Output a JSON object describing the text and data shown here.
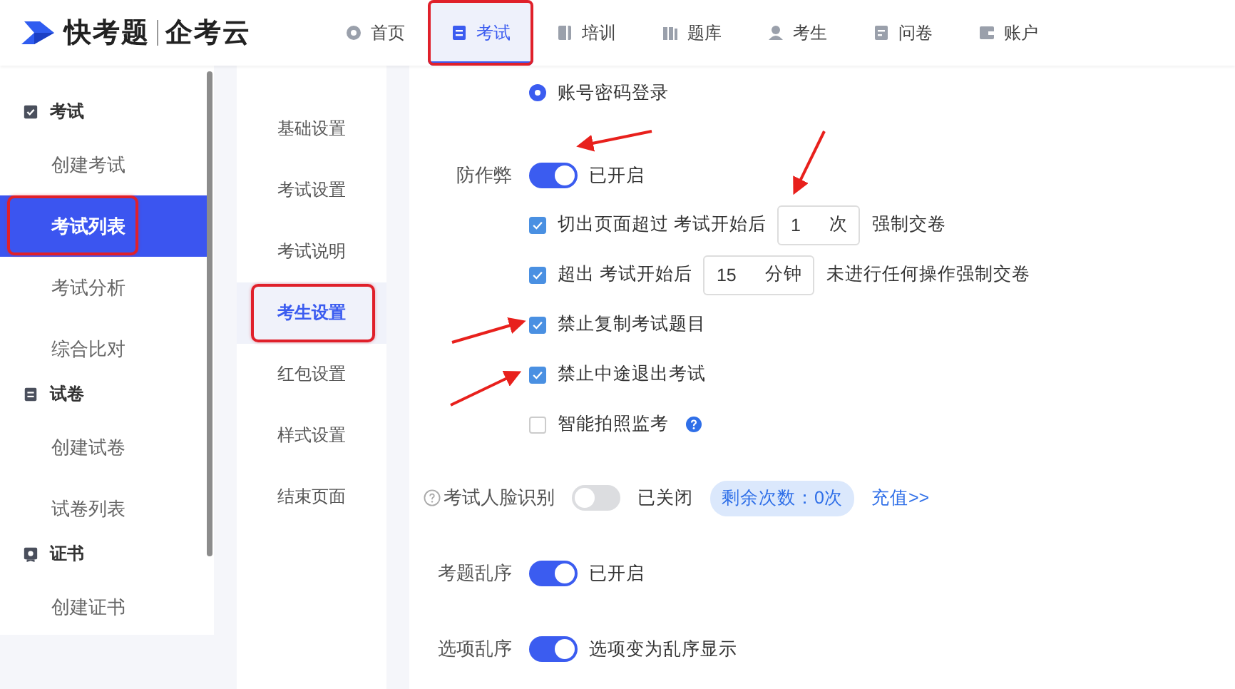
{
  "header": {
    "logo_name": "快考题",
    "logo_sub": "企考云",
    "nav": [
      {
        "label": "首页",
        "selected": false,
        "highlighted": false
      },
      {
        "label": "考试",
        "selected": true,
        "highlighted": true
      },
      {
        "label": "培训",
        "selected": false,
        "highlighted": false
      },
      {
        "label": "题库",
        "selected": false,
        "highlighted": false
      },
      {
        "label": "考生",
        "selected": false,
        "highlighted": false
      },
      {
        "label": "问卷",
        "selected": false,
        "highlighted": false
      },
      {
        "label": "账户",
        "selected": false,
        "highlighted": false
      }
    ]
  },
  "sidebar": {
    "groups": [
      {
        "title": "考试",
        "items": [
          {
            "label": "创建考试",
            "selected": false,
            "highlighted": false
          },
          {
            "label": "考试列表",
            "selected": true,
            "highlighted": true
          },
          {
            "label": "考试分析",
            "selected": false,
            "highlighted": false
          },
          {
            "label": "综合比对",
            "selected": false,
            "highlighted": false
          }
        ]
      },
      {
        "title": "试卷",
        "items": [
          {
            "label": "创建试卷",
            "selected": false,
            "highlighted": false
          },
          {
            "label": "试卷列表",
            "selected": false,
            "highlighted": false
          }
        ]
      },
      {
        "title": "证书",
        "items": [
          {
            "label": "创建证书",
            "selected": false,
            "highlighted": false
          }
        ]
      }
    ]
  },
  "subnav": [
    {
      "label": "基础设置",
      "selected": false,
      "highlighted": false
    },
    {
      "label": "考试设置",
      "selected": false,
      "highlighted": false
    },
    {
      "label": "考试说明",
      "selected": false,
      "highlighted": false
    },
    {
      "label": "考生设置",
      "selected": true,
      "highlighted": true
    },
    {
      "label": "红包设置",
      "selected": false,
      "highlighted": false
    },
    {
      "label": "样式设置",
      "selected": false,
      "highlighted": false
    },
    {
      "label": "结束页面",
      "selected": false,
      "highlighted": false
    }
  ],
  "login_option": {
    "label": "账号密码登录",
    "selected": true
  },
  "anti_cheat": {
    "label": "防作弊",
    "on": true,
    "status": "已开启",
    "options": [
      {
        "kind": "input",
        "checked": true,
        "before": "切出页面超过 考试开始后",
        "value": "1",
        "unit": "次",
        "after": "强制交卷"
      },
      {
        "kind": "input",
        "checked": true,
        "before": "超出 考试开始后",
        "value": "15",
        "unit": "分钟",
        "after": "未进行任何操作强制交卷"
      },
      {
        "kind": "text",
        "checked": true,
        "label": "禁止复制考试题目",
        "help": false
      },
      {
        "kind": "text",
        "checked": true,
        "label": "禁止中途退出考试",
        "help": false
      },
      {
        "kind": "text",
        "checked": false,
        "label": "智能拍照监考",
        "help": true
      }
    ]
  },
  "face": {
    "label": "考试人脸识别",
    "on": false,
    "status": "已关闭",
    "badge": "剩余次数：0次",
    "link": "充值>>"
  },
  "switches": [
    {
      "label": "考题乱序",
      "on": true,
      "status": "已开启"
    },
    {
      "label": "选项乱序",
      "on": true,
      "status": "选项变为乱序显示"
    }
  ]
}
